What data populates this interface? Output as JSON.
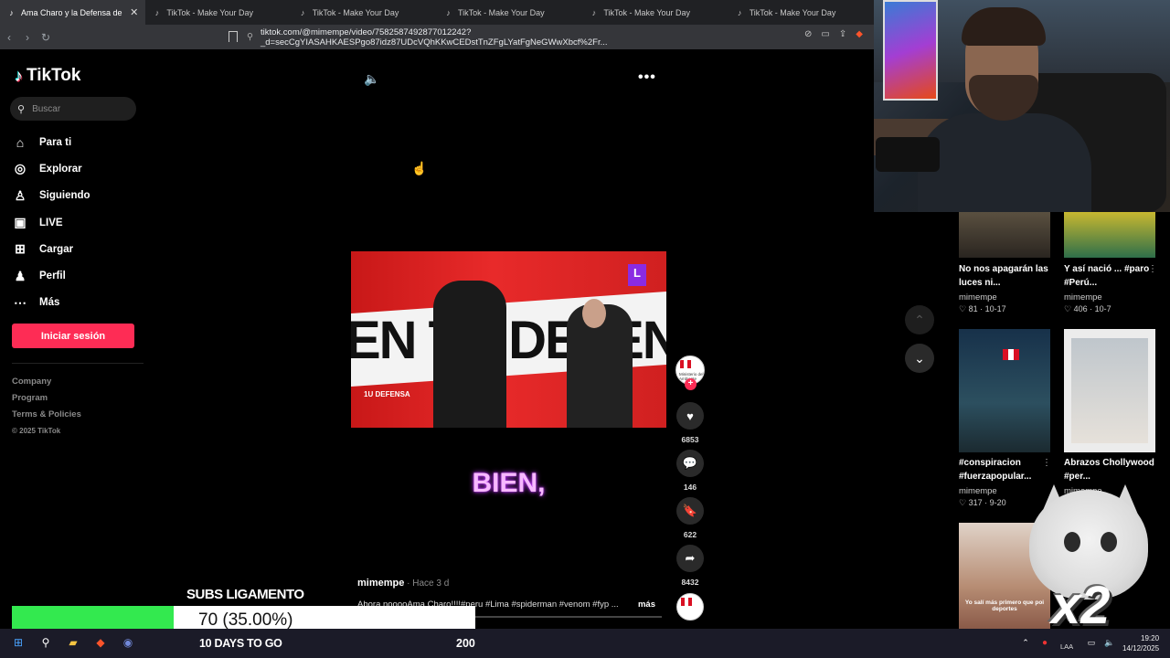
{
  "browser": {
    "tabs": [
      {
        "label": "Ama Charo y la Defensa de S",
        "active": true
      },
      {
        "label": "TikTok - Make Your Day",
        "active": false
      },
      {
        "label": "TikTok - Make Your Day",
        "active": false
      },
      {
        "label": "TikTok - Make Your Day",
        "active": false
      },
      {
        "label": "TikTok - Make Your Day",
        "active": false
      },
      {
        "label": "TikTok - Make Your Day",
        "active": false
      }
    ],
    "url": "tiktok.com/@mimempe/video/7582587492877012242?_d=secCgYIASAHKAESPgo87idz87UDcVQhKKwCEDstTnZFgLYatFgNeGWwXbcf%2Fr..."
  },
  "tiktok": {
    "brand": "TikTok",
    "search_placeholder": "Buscar",
    "nav": [
      "Para ti",
      "Explorar",
      "Siguiendo",
      "LIVE",
      "Cargar",
      "Perfil",
      "Más"
    ],
    "login_label": "Iniciar sesión",
    "footer": [
      "Company",
      "Program",
      "Terms & Policies",
      "© 2025 TikTok"
    ]
  },
  "video": {
    "caption": "BIEN,",
    "author": "mimempe",
    "time": " · Hace 3 d",
    "description": "Abora nooooAma Charo!!!!#peru #Lima #spiderman #venom #fyp ...",
    "more_label": "más",
    "overlay_badge": "1U DEFENSA",
    "channel_logo": "L",
    "avatar_text": "Ministerio del Ambiente",
    "likes": "6853",
    "comments": "146",
    "saves": "622",
    "shares": "8432"
  },
  "feed": [
    {
      "title": "No nos apagarán las luces ni...",
      "user": "mimempe",
      "likes": "81",
      "date": "10-17"
    },
    {
      "title": "Y así nació ... #paro #Perú...",
      "user": "mimempe",
      "likes": "406",
      "date": "10-7"
    },
    {
      "title": "#conspiracion #fuerzapopular...",
      "user": "mimempe",
      "likes": "317",
      "date": "9-20"
    },
    {
      "title": "Abrazos Chollywood #per...",
      "user": "mimempe",
      "likes": "",
      "date": ""
    },
    {
      "thumb_text": "Yo salí más primero que poi deportes"
    }
  ],
  "stream": {
    "subs_title": "SUBS LIGAMENTO",
    "goal_text": "70 (35.00%)",
    "goal_fraction": 0.35,
    "days_text": "10 DAYS TO GO",
    "goal_target": "200",
    "multiplier": "x2"
  },
  "taskbar": {
    "language": "LAA",
    "time": "19:20",
    "date": "14/12/2025"
  },
  "colors": {
    "accent": "#fe2c55",
    "progress": "#33e94f"
  }
}
